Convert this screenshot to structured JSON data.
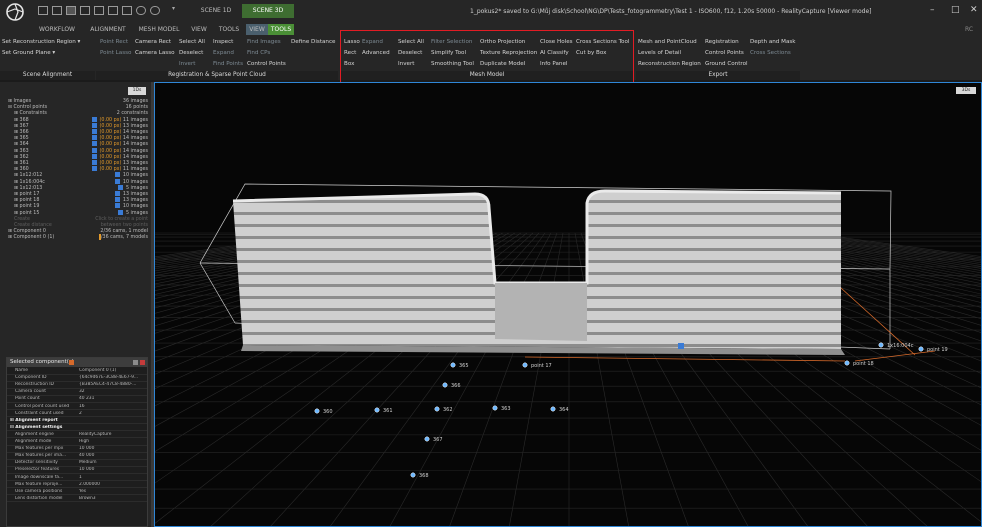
{
  "window": {
    "title": "1_pokus2* saved to G:\\Můj disk\\School\\NG\\DP\\Tests_fotogrammetry\\Test 1 - ISO600, f12, 1.20s 50000 - RealityCapture [Viewer mode]",
    "scene_tabs": [
      "SCENE 1D",
      "SCENE 3D"
    ],
    "minimize": "–",
    "maximize": "□",
    "close": "✕",
    "user": "RC"
  },
  "tabs": [
    "WORKFLOW",
    "ALIGNMENT",
    "MESH MODEL",
    "VIEW",
    "TOOLS"
  ],
  "ribbon": {
    "scene_alignment": {
      "label": "Scene Alignment",
      "items": [
        "Set Reconstruction Region ▾",
        "Set Ground Plane ▾"
      ]
    },
    "registration": {
      "label": "Registration & Sparse Point Cloud",
      "items": [
        "Point Rect",
        "Camera Rect",
        "Point Lasso",
        "Camera Lasso",
        "Select All",
        "Deselect",
        "Invert",
        "Inspect",
        "Expand",
        "Find Points",
        "Find Images",
        "Find CPs",
        "Control Points",
        "Define Distance"
      ]
    },
    "mesh_model": {
      "label": "Mesh Model",
      "items": [
        "Lasso",
        "Expand",
        "Rect",
        "Advanced",
        "Box",
        "Select All",
        "Deselect",
        "Invert",
        "Filter Selection",
        "Simplify Tool",
        "Smoothing Tool",
        "Ortho Projection",
        "Texture Reprojection",
        "Duplicate Model",
        "Close Holes",
        "AI Classify",
        "Info Panel",
        "Cross Sections Tool",
        "Cut by Box"
      ]
    },
    "export": {
      "label": "Export",
      "items": [
        "Mesh and PointCloud",
        "Levels of Detail",
        "Reconstruction Region",
        "Registration",
        "Control Points",
        "Ground Control",
        "Depth and Mask",
        "Cross Sections"
      ]
    }
  },
  "tree": {
    "badge": "1Ds",
    "rows": [
      {
        "name": "⊞ Images",
        "value": "36 images",
        "level": 0
      },
      {
        "name": "⊟ Control points",
        "value": "16 points",
        "level": 0
      },
      {
        "name": "⊞ Constraints",
        "value": "2 constraints",
        "level": 1
      },
      {
        "name": "⊞ 368",
        "tag": "(0.00 px)",
        "value": "11 images",
        "check": true,
        "level": 1
      },
      {
        "name": "⊞ 367",
        "tag": "(0.00 px)",
        "value": "13 images",
        "check": true,
        "level": 1
      },
      {
        "name": "⊞ 366",
        "tag": "(0.00 px)",
        "value": "14 images",
        "check": true,
        "level": 1
      },
      {
        "name": "⊞ 365",
        "tag": "(0.00 px)",
        "value": "14 images",
        "check": true,
        "level": 1
      },
      {
        "name": "⊞ 364",
        "tag": "(0.00 px)",
        "value": "14 images",
        "check": true,
        "level": 1
      },
      {
        "name": "⊞ 363",
        "tag": "(0.00 px)",
        "value": "14 images",
        "check": true,
        "level": 1
      },
      {
        "name": "⊞ 362",
        "tag": "(0.00 px)",
        "value": "14 images",
        "check": true,
        "level": 1
      },
      {
        "name": "⊞ 361",
        "tag": "(0.00 px)",
        "value": "13 images",
        "check": true,
        "level": 1
      },
      {
        "name": "⊞ 360",
        "tag": "(0.00 px)",
        "value": "11 images",
        "check": true,
        "level": 1
      },
      {
        "name": "⊞ 1x12:012",
        "value": "10 images",
        "check": true,
        "level": 1
      },
      {
        "name": "⊞ 1x16:004c",
        "value": "10 images",
        "check": true,
        "level": 1
      },
      {
        "name": "⊞ 1x12:013",
        "value": "5 images",
        "check": true,
        "level": 1
      },
      {
        "name": "⊞ point 17",
        "value": "13 images",
        "check": true,
        "level": 1
      },
      {
        "name": "⊞ point 18",
        "value": "13 images",
        "check": true,
        "level": 1
      },
      {
        "name": "⊞ point 19",
        "value": "10 images",
        "check": true,
        "level": 1
      },
      {
        "name": "⊞ point 15",
        "value": "5 images",
        "check": true,
        "level": 1
      },
      {
        "name": "Create",
        "value": "Click to create a point",
        "level": 1,
        "dim": true
      },
      {
        "name": "Create distance",
        "value": "between two points",
        "level": 1,
        "dim": true
      },
      {
        "name": "⊞ Component 0",
        "value": "2/36 cams, 1 model",
        "level": 0
      },
      {
        "name": "⊞ Component 0 (1)",
        "value": "/36 cams, 7 models",
        "level": 0,
        "bar": true
      }
    ]
  },
  "selected_panel": {
    "title": "Selected component(s)",
    "rows": [
      {
        "key": "Name",
        "value": "Component 0 (1)"
      },
      {
        "key": "Component ID",
        "value": "{64c9d67E-3C88-4E67-9..."
      },
      {
        "key": "Reconstruction ID",
        "value": "{B385AEC4-47C8-4880-..."
      },
      {
        "key": "Camera count",
        "value": "32"
      },
      {
        "key": "Point count",
        "value": "40 231"
      },
      {
        "key": "Control point count used",
        "value": "16"
      },
      {
        "key": "Constraint count used",
        "value": "2"
      },
      {
        "key": "⊞ Alignment report",
        "value": "",
        "section": true
      },
      {
        "key": "⊟ Alignment settings",
        "value": "",
        "section": true
      },
      {
        "key": "Alignment engine",
        "value": "RealityCapture"
      },
      {
        "key": "Alignment mode",
        "value": "High"
      },
      {
        "key": "Max features per mpx",
        "value": "10 000"
      },
      {
        "key": "Max features per ima...",
        "value": "40 000"
      },
      {
        "key": "Detector sensitivity",
        "value": "Medium"
      },
      {
        "key": "Preselector features",
        "value": "10 000"
      },
      {
        "key": "Image downscale fa...",
        "value": "1"
      },
      {
        "key": "Max feature reproje...",
        "value": "2.000000"
      },
      {
        "key": "Use camera positions",
        "value": "Yes"
      },
      {
        "key": "Lens distortion model",
        "value": "Brown3"
      }
    ]
  },
  "viewport": {
    "badge": "3Ds",
    "control_points": [
      "365",
      "point 17",
      "366",
      "360",
      "361",
      "362",
      "363",
      "364",
      "367",
      "368",
      "1x16:004c",
      "point 19",
      "point 18"
    ]
  }
}
